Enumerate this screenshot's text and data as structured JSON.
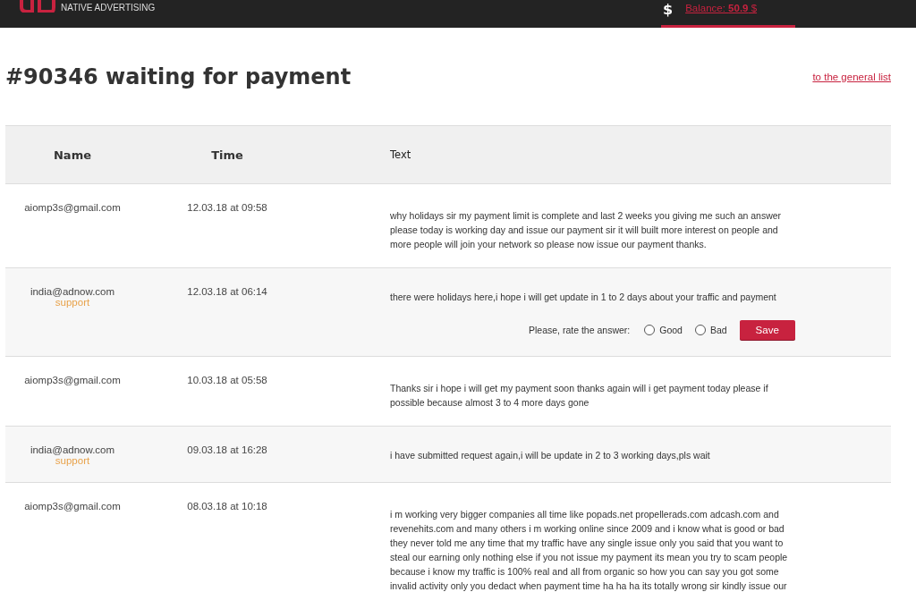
{
  "header": {
    "logo_subtitle": "NATIVE ADVERTISING",
    "currency_symbol": "$",
    "balance": "Balance: **50.9** $"
  },
  "page": {
    "title": "#90346 waiting for payment",
    "back_link": "to the general list"
  },
  "table": {
    "columns": [
      "Name",
      "Time",
      "Text"
    ],
    "rows": [
      {
        "name": "aiomp3s@gmail.com",
        "time": "12.03.18 at 09:58",
        "text": "why holidays sir my payment limit is complete and last 2 weeks you giving me such an answer\nplease today is working day and issue our payment sir it will built more interest on people and\nmore people will join your network so please now issue our payment thanks.",
        "support": false
      },
      {
        "name": "india@adnow.com",
        "role": "support",
        "time": "12.03.18 at 06:14",
        "text": "there were holidays here,i hope i will get update in 1 to 2 days about your traffic and payment",
        "support": true,
        "rating": {
          "prompt": "Please, rate the answer:",
          "options": [
            {
              "label": "Good",
              "selected": false
            },
            {
              "label": "Bad",
              "selected": false
            }
          ],
          "button": "Save"
        }
      },
      {
        "name": "aiomp3s@gmail.com",
        "time": "10.03.18 at 05:58",
        "text": "Thanks sir i hope i will get my payment soon thanks again will i get payment today please if\npossible because almost 3 to 4 more days gone",
        "support": false
      },
      {
        "name": "india@adnow.com",
        "role": "support",
        "time": "09.03.18 at 16:28",
        "text": "i have submitted request again,i will be update in 2 to 3 working days,pls wait",
        "support": true
      },
      {
        "name": "aiomp3s@gmail.com",
        "time": "08.03.18 at 10:18",
        "text": "i m working very bigger companies all time like popads.net propellerads.com adcash.com and\nrevenehits.com and many others i m working online since 2009 and i know what is good or bad\nthey never told me any time that my traffic have any single issue only you said that you want to\nsteal our earning only nothing else if you not issue my payment its mean you try to scam people\nbecause i know my traffic is 100% real and all from organic so how you can say you got some\ninvalid activity only you dedact when payment time ha ha ha its totally wrong sir kindly issue our",
        "support": false
      }
    ]
  }
}
